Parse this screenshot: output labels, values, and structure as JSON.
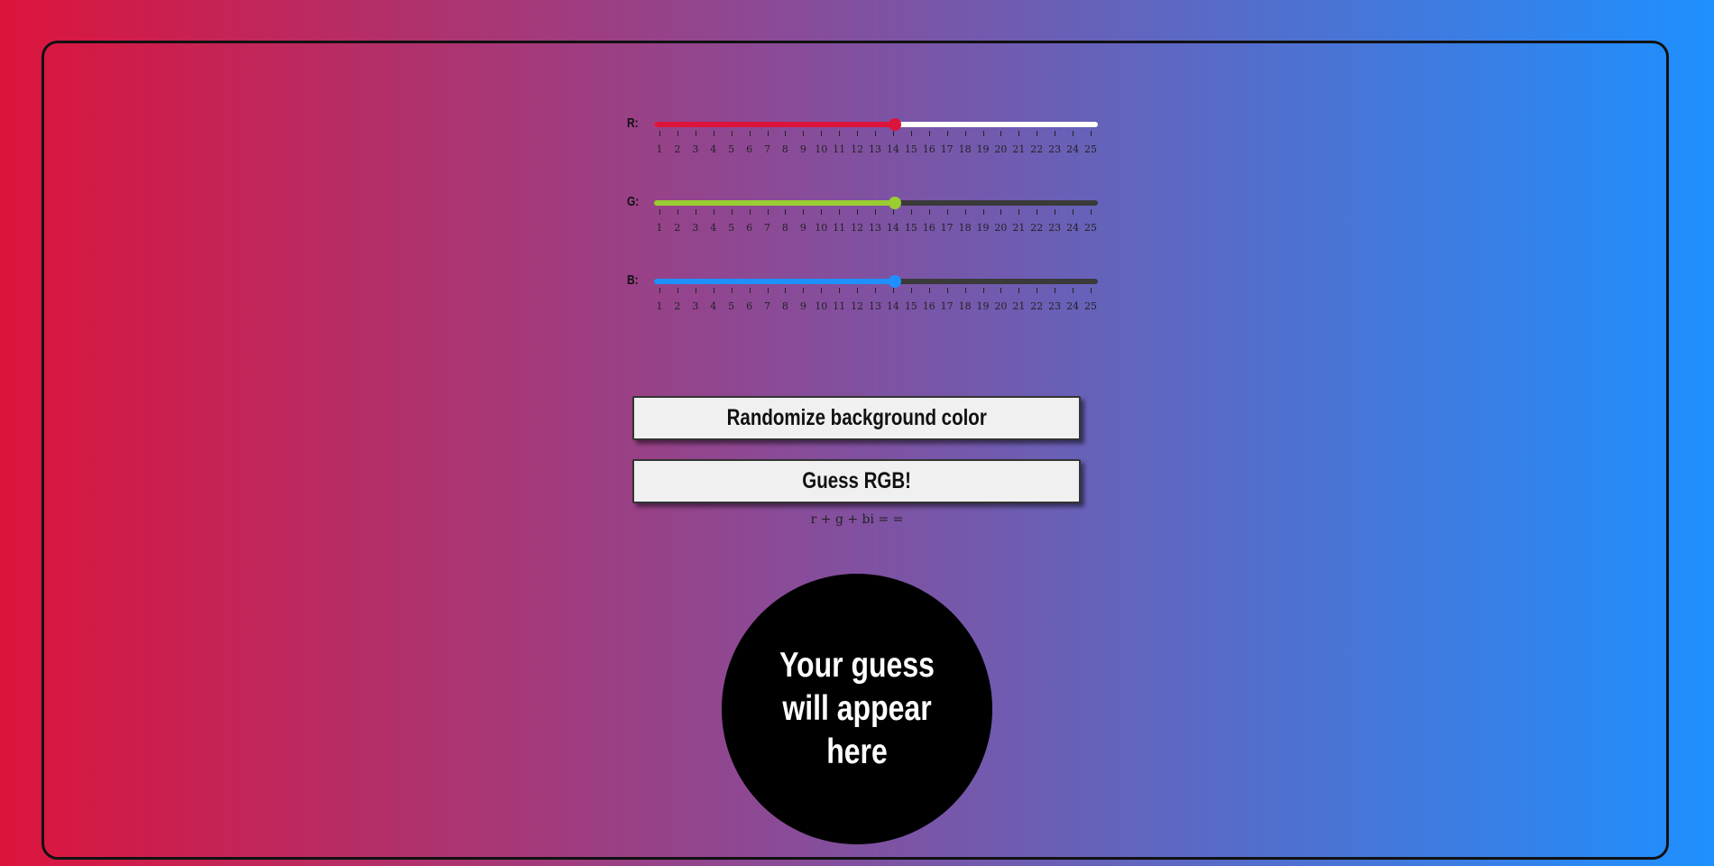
{
  "sliders": [
    {
      "id": "r",
      "label": "R:",
      "value": 14,
      "min": 1,
      "max": 25,
      "fill_color": "#dc143c",
      "track_color": "#ffffff"
    },
    {
      "id": "g",
      "label": "G:",
      "value": 14,
      "min": 1,
      "max": 25,
      "fill_color": "#9acd32",
      "track_color": "#3a3a3a"
    },
    {
      "id": "b",
      "label": "B:",
      "value": 14,
      "min": 1,
      "max": 25,
      "fill_color": "#1e90ff",
      "track_color": "#3a3a3a"
    }
  ],
  "tick_labels": [
    "1",
    "2",
    "3",
    "4",
    "5",
    "6",
    "7",
    "8",
    "9",
    "10",
    "11",
    "12",
    "13",
    "14",
    "15",
    "16",
    "17",
    "18",
    "19",
    "20",
    "21",
    "22",
    "23",
    "24",
    "25"
  ],
  "buttons": {
    "randomize_label": "Randomize background color",
    "guess_label": "Guess RGB!"
  },
  "formula_text": "r + g + bi = =",
  "guess_circle": {
    "message": "Your guess will appear here",
    "color": "#000000"
  },
  "colors": {
    "gradient_start": "#dc143c",
    "gradient_end": "#1e90ff"
  }
}
